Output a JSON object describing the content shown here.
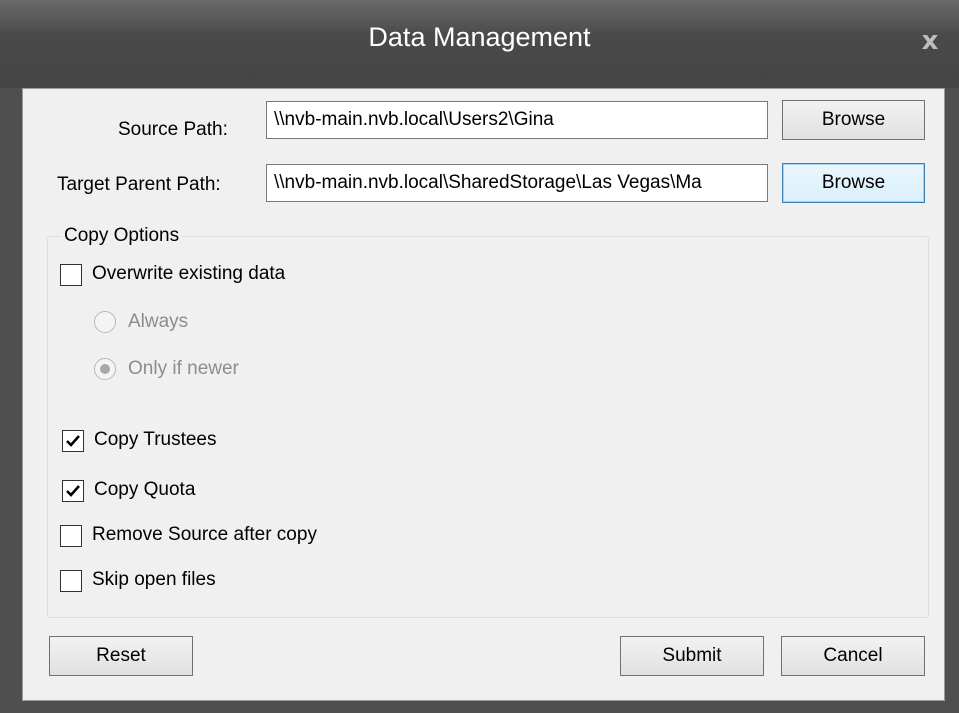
{
  "window": {
    "title": "Data Management",
    "close_symbol": "x"
  },
  "paths": {
    "source_label": "Source Path:",
    "source_value": "\\\\nvb-main.nvb.local\\Users2\\Gina",
    "target_label": "Target Parent Path:",
    "target_value": "\\\\nvb-main.nvb.local\\SharedStorage\\Las Vegas\\Ma",
    "browse_label": "Browse"
  },
  "copy_options": {
    "title": "Copy Options",
    "overwrite": {
      "label": "Overwrite existing data",
      "checked": false
    },
    "radio_always": {
      "label": "Always",
      "selected": false,
      "enabled": false
    },
    "radio_newer": {
      "label": "Only if newer",
      "selected": true,
      "enabled": false
    },
    "copy_trustees": {
      "label": "Copy Trustees",
      "checked": true
    },
    "copy_quota": {
      "label": "Copy Quota",
      "checked": true
    },
    "remove_source": {
      "label": "Remove Source after copy",
      "checked": false
    },
    "skip_open": {
      "label": "Skip open files",
      "checked": false
    }
  },
  "buttons": {
    "reset": "Reset",
    "submit": "Submit",
    "cancel": "Cancel"
  }
}
